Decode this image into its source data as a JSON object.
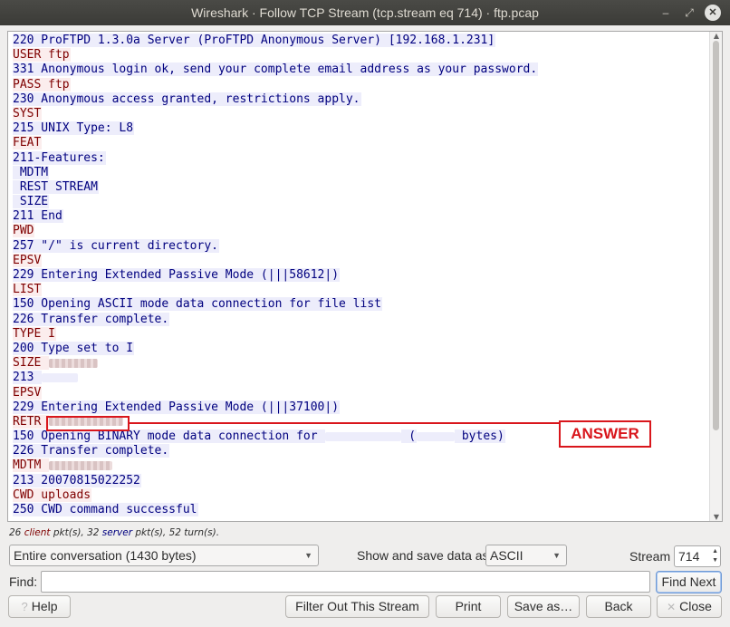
{
  "window": {
    "title": "Wireshark · Follow TCP Stream (tcp.stream eq 714) · ftp.pcap",
    "min_icon": "minimize-icon",
    "max_icon": "maximize-icon",
    "close_icon": "close-icon"
  },
  "stream_lines": [
    {
      "side": "server",
      "text": "220 ProFTPD 1.3.0a Server (ProFTPD Anonymous Server) [192.168.1.231]"
    },
    {
      "side": "client",
      "text": "USER ftp"
    },
    {
      "side": "server",
      "text": "331 Anonymous login ok, send your complete email address as your password."
    },
    {
      "side": "client",
      "text": "PASS ftp"
    },
    {
      "side": "server",
      "text": "230 Anonymous access granted, restrictions apply."
    },
    {
      "side": "client",
      "text": "SYST"
    },
    {
      "side": "server",
      "text": "215 UNIX Type: L8"
    },
    {
      "side": "client",
      "text": "FEAT"
    },
    {
      "side": "server",
      "text": "211-Features:"
    },
    {
      "side": "server",
      "text": " MDTM"
    },
    {
      "side": "server",
      "text": " REST STREAM"
    },
    {
      "side": "server",
      "text": " SIZE"
    },
    {
      "side": "server",
      "text": "211 End"
    },
    {
      "side": "client",
      "text": "PWD"
    },
    {
      "side": "server",
      "text": "257 \"/\" is current directory."
    },
    {
      "side": "client",
      "text": "EPSV"
    },
    {
      "side": "server",
      "text": "229 Entering Extended Passive Mode (|||58612|)"
    },
    {
      "side": "client",
      "text": "LIST"
    },
    {
      "side": "server",
      "text": "150 Opening ASCII mode data connection for file list"
    },
    {
      "side": "server",
      "text": "226 Transfer complete."
    },
    {
      "side": "client",
      "text": "TYPE I"
    },
    {
      "side": "server",
      "text": "200 Type set to I"
    },
    {
      "side": "client",
      "text": "SIZE "
    },
    {
      "side": "server",
      "text": "213 "
    },
    {
      "side": "client",
      "text": "EPSV"
    },
    {
      "side": "server",
      "text": "229 Entering Extended Passive Mode (|||37100|)"
    },
    {
      "side": "client",
      "text": "RETR "
    },
    {
      "side": "server",
      "text": "150 Opening BINARY mode data connection for ",
      "tail": " (",
      "tail2": " bytes)"
    },
    {
      "side": "server",
      "text": "226 Transfer complete."
    },
    {
      "side": "client",
      "text": "MDTM "
    },
    {
      "side": "server",
      "text": "213 20070815022252"
    },
    {
      "side": "client",
      "text": "CWD uploads"
    },
    {
      "side": "server",
      "text": "250 CWD command successful"
    }
  ],
  "annotation": {
    "label": "ANSWER",
    "color": "#d9161c"
  },
  "stats": {
    "client_count": "26 ",
    "client_word": "client",
    "mid": " pkt(s), 32 ",
    "server_word": "server",
    "tail": " pkt(s), 52 turn(s)."
  },
  "controls": {
    "conversation_select": "Entire conversation (1430 bytes)",
    "show_save_label": "Show and save data as",
    "format_select": "ASCII",
    "stream_label": "Stream",
    "stream_value": "714",
    "find_label": "Find:",
    "find_value": "",
    "find_next_label": "Find Next"
  },
  "buttons": {
    "help": "Help",
    "filter_out": "Filter Out This Stream",
    "print": "Print",
    "save_as": "Save as…",
    "back": "Back",
    "close": "Close"
  },
  "colors": {
    "client_text": "#7f0000",
    "client_bg": "#fbeded",
    "server_text": "#00007f",
    "server_bg": "#ededfb"
  }
}
